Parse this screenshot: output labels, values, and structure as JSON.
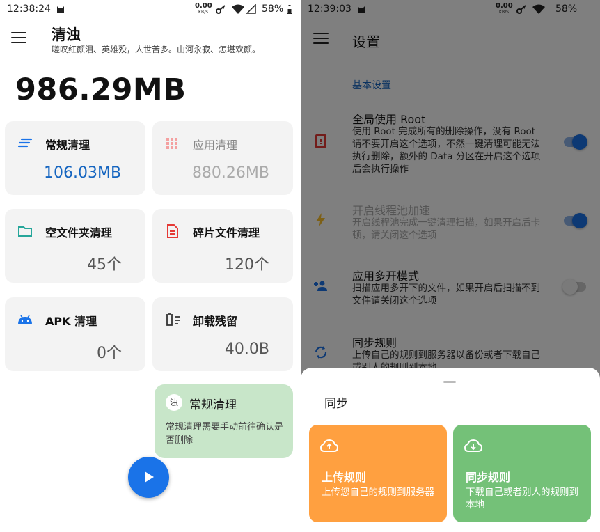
{
  "left": {
    "status_bar": {
      "time": "12:38:24",
      "speed_value": "0.00",
      "speed_unit": "KB/S",
      "battery": "58%"
    },
    "app_title": "清浊",
    "app_subtitle": "嗟叹红颜泪、英雄殁，人世苦多。山河永寂、怎堪欢颜。",
    "total_size": "986.29MB",
    "cards": [
      {
        "label": "常规清理",
        "value": "106.03MB",
        "icon": "lines-icon"
      },
      {
        "label": "应用清理",
        "value": "880.26MB",
        "icon": "grid-icon"
      },
      {
        "label": "空文件夹清理",
        "value": "45个",
        "icon": "folder-icon"
      },
      {
        "label": "碎片文件清理",
        "value": "120个",
        "icon": "document-icon"
      },
      {
        "label": "APK 清理",
        "value": "0个",
        "icon": "android-icon"
      },
      {
        "label": "卸载残留",
        "value": "40.0B",
        "icon": "trash-list-icon"
      }
    ],
    "toast": {
      "app_icon_char": "浊",
      "title": "常规清理",
      "body": "常规清理需要手动前往确认是否删除"
    }
  },
  "right": {
    "status_bar": {
      "time": "12:39:03",
      "speed_value": "0.00",
      "speed_unit": "KB/S",
      "battery": "58%"
    },
    "title": "设置",
    "section_header": "基本设置",
    "items": [
      {
        "title": "全局使用 Root",
        "desc": "使用 Root 完成所有的删除操作，没有 Root 请不要开启这个选项，不然一键清理可能无法执行删除，额外的 Data 分区在开启这个选项后会执行操作",
        "toggle": true
      },
      {
        "title": "开启线程池加速",
        "desc": "开启线程池完成一键清理扫描，如果开启后卡顿，请关闭这个选项",
        "toggle": true
      },
      {
        "title": "应用多开模式",
        "desc": "扫描应用多开下的文件，如果开启后扫描不到文件请关闭这个选项",
        "toggle": false
      },
      {
        "title": "同步规则",
        "desc": "上传自己的规则到服务器以备份或者下载自己或别人的规则到本地"
      }
    ],
    "sheet": {
      "title": "同步",
      "upload": {
        "title": "上传规则",
        "desc": "上传您自己的规则到服务器"
      },
      "sync": {
        "title": "同步规则",
        "desc": "下载自己或者别人的规则到本地"
      }
    }
  },
  "colors": {
    "accent_blue": "#1a73e8",
    "section_blue": "#1565c0",
    "toast_green": "#c8e6c9",
    "upload_orange": "#ffa040",
    "sync_green": "#74c178"
  }
}
